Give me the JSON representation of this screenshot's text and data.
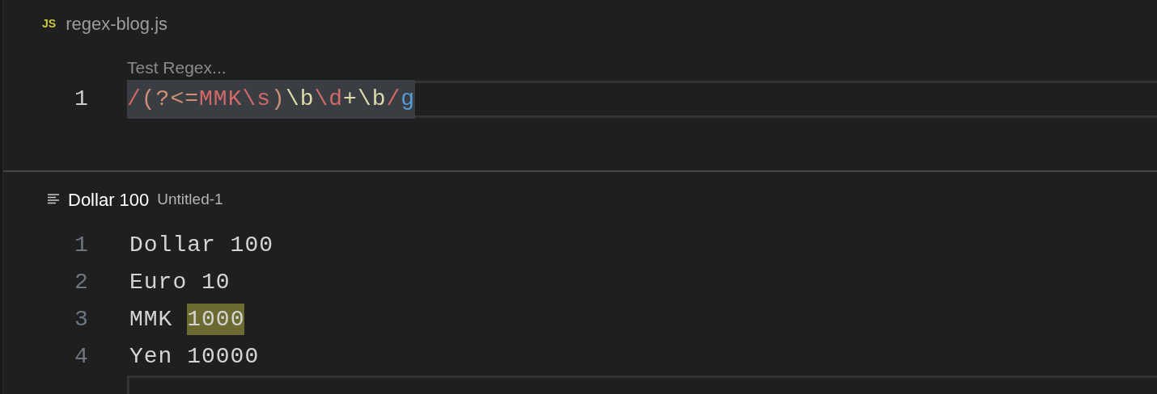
{
  "regex_editor": {
    "tab": {
      "icon_label": "JS",
      "title": "regex-blog.js"
    },
    "hint_label": "Test Regex...",
    "lines": [
      {
        "number": "1",
        "current": true,
        "tokens": [
          {
            "text": "/",
            "color": "#d16969"
          },
          {
            "text": "(?<=",
            "color": "#ce9178"
          },
          {
            "text": "MMK",
            "color": "#d16969"
          },
          {
            "text": "\\s",
            "color": "#d16969"
          },
          {
            "text": ")",
            "color": "#ce9178"
          },
          {
            "text": "\\b",
            "color": "#dcdcaa"
          },
          {
            "text": "\\d",
            "color": "#d16969"
          },
          {
            "text": "+",
            "color": "#dcdcaa"
          },
          {
            "text": "\\b",
            "color": "#dcdcaa"
          },
          {
            "text": "/",
            "color": "#d16969"
          },
          {
            "text": "g",
            "color": "#569cd6"
          }
        ]
      }
    ]
  },
  "text_editor": {
    "tab": {
      "title": "Dollar 100",
      "description": "Untitled-1"
    },
    "lines": [
      {
        "number": "1",
        "current": false,
        "segments": [
          {
            "text": "Dollar 100",
            "match": false
          }
        ]
      },
      {
        "number": "2",
        "current": false,
        "segments": [
          {
            "text": "Euro 10",
            "match": false
          }
        ]
      },
      {
        "number": "3",
        "current": false,
        "segments": [
          {
            "text": "MMK ",
            "match": false
          },
          {
            "text": "1000",
            "match": true
          }
        ]
      },
      {
        "number": "4",
        "current": false,
        "segments": [
          {
            "text": "Yen 10000",
            "match": false
          }
        ]
      },
      {
        "current": true
      }
    ]
  }
}
